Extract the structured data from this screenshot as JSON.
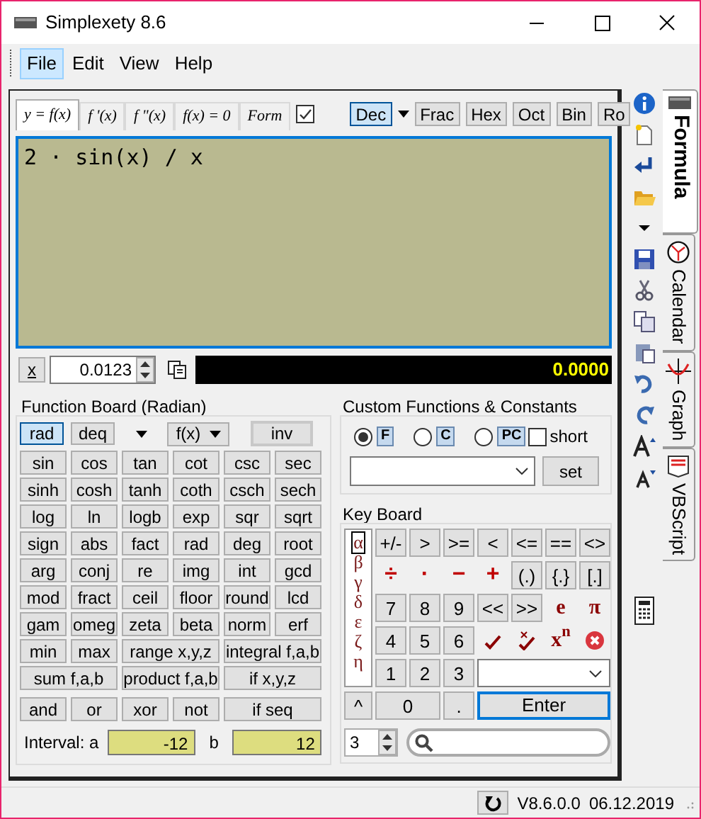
{
  "window": {
    "title": "Simplexety 8.6"
  },
  "menu": [
    {
      "label": "File",
      "highlighted": true
    },
    {
      "label": "Edit",
      "highlighted": false
    },
    {
      "label": "View",
      "highlighted": false
    },
    {
      "label": "Help",
      "highlighted": false
    }
  ],
  "formula_tabs": [
    {
      "label": "y = f(x)",
      "selected": true
    },
    {
      "label": "f '(x)",
      "selected": false
    },
    {
      "label": "f \"(x)",
      "selected": false
    },
    {
      "label": "f(x) = 0",
      "selected": false
    },
    {
      "label": "Form",
      "selected": false
    }
  ],
  "formula_checkbox": {
    "checked": true
  },
  "number_formats": [
    {
      "label": "Dec",
      "selected": true
    },
    {
      "label": "Frac",
      "selected": false
    },
    {
      "label": "Hex",
      "selected": false
    },
    {
      "label": "Oct",
      "selected": false
    },
    {
      "label": "Bin",
      "selected": false
    },
    {
      "label": "Ro",
      "selected": false
    }
  ],
  "expression": "2 · sin(x) / x",
  "x_button": "x",
  "x_value": "0.0123",
  "result": "0.0000",
  "function_board": {
    "title": "Function Board (Radian)",
    "modes": [
      {
        "label": "rad",
        "selected": true
      },
      {
        "label": "deq",
        "selected": false
      }
    ],
    "fx_dropdown": "f(x)",
    "inv_button": "inv",
    "buttons": [
      {
        "label": "sin",
        "kind": "single"
      },
      {
        "label": "cos",
        "kind": "single"
      },
      {
        "label": "tan",
        "kind": "single"
      },
      {
        "label": "cot",
        "kind": "single"
      },
      {
        "label": "csc",
        "kind": "single"
      },
      {
        "label": "sec",
        "kind": "single"
      },
      {
        "label": "sinh",
        "kind": "single"
      },
      {
        "label": "cosh",
        "kind": "single"
      },
      {
        "label": "tanh",
        "kind": "single"
      },
      {
        "label": "coth",
        "kind": "single"
      },
      {
        "label": "csch",
        "kind": "single"
      },
      {
        "label": "sech",
        "kind": "single"
      },
      {
        "label": "log",
        "kind": "single"
      },
      {
        "label": "ln",
        "kind": "single"
      },
      {
        "label": "logb",
        "kind": "single"
      },
      {
        "label": "exp",
        "kind": "single"
      },
      {
        "label": "sqr",
        "kind": "single"
      },
      {
        "label": "sqrt",
        "kind": "single"
      },
      {
        "label": "sign",
        "kind": "single"
      },
      {
        "label": "abs",
        "kind": "single"
      },
      {
        "label": "fact",
        "kind": "single"
      },
      {
        "label": "rad",
        "kind": "single"
      },
      {
        "label": "deg",
        "kind": "single"
      },
      {
        "label": "root",
        "kind": "single"
      },
      {
        "label": "arg",
        "kind": "single"
      },
      {
        "label": "conj",
        "kind": "single"
      },
      {
        "label": "re",
        "kind": "single"
      },
      {
        "label": "img",
        "kind": "single"
      },
      {
        "label": "int",
        "kind": "single"
      },
      {
        "label": "gcd",
        "kind": "single"
      },
      {
        "label": "mod",
        "kind": "single"
      },
      {
        "label": "fract",
        "kind": "single"
      },
      {
        "label": "ceil",
        "kind": "single"
      },
      {
        "label": "floor",
        "kind": "single"
      },
      {
        "label": "round",
        "kind": "single"
      },
      {
        "label": "lcd",
        "kind": "single"
      },
      {
        "label": "gam",
        "kind": "single"
      },
      {
        "label": "omeg",
        "kind": "single"
      },
      {
        "label": "zeta",
        "kind": "single"
      },
      {
        "label": "beta",
        "kind": "single"
      },
      {
        "label": "norm",
        "kind": "single"
      },
      {
        "label": "erf",
        "kind": "single"
      },
      {
        "label": "min",
        "kind": "single"
      },
      {
        "label": "max",
        "kind": "single"
      },
      {
        "label": "range x,y,z",
        "kind": "wide"
      },
      {
        "label": "integral f,a,b",
        "kind": "wide"
      },
      {
        "label": "sum f,a,b",
        "kind": "wide"
      },
      {
        "label": "product f,a,b",
        "kind": "wide"
      },
      {
        "label": "if x,y,z",
        "kind": "wide"
      }
    ],
    "logic_buttons": [
      {
        "label": "and",
        "kind": "single"
      },
      {
        "label": "or",
        "kind": "single"
      },
      {
        "label": "xor",
        "kind": "single"
      },
      {
        "label": "not",
        "kind": "single"
      },
      {
        "label": "if seq",
        "kind": "wide"
      }
    ],
    "interval": {
      "label_a": "Interval: a",
      "a": "-12",
      "label_b": "b",
      "b": "12"
    }
  },
  "custom": {
    "title": "Custom Functions & Constants",
    "options": [
      {
        "label": "F",
        "selected": true
      },
      {
        "label": "C",
        "selected": false
      },
      {
        "label": "PC",
        "selected": false
      }
    ],
    "short": {
      "label": "short",
      "checked": false
    },
    "set_button": "set"
  },
  "keyboard": {
    "title": "Key Board",
    "greek": [
      {
        "label": "α",
        "selected": true
      },
      {
        "label": "β",
        "selected": false
      },
      {
        "label": "γ",
        "selected": false
      },
      {
        "label": "δ",
        "selected": false
      },
      {
        "label": "ε",
        "selected": false
      },
      {
        "label": "ζ",
        "selected": false
      },
      {
        "label": "η",
        "selected": false
      }
    ],
    "keys": [
      {
        "label": "+/-",
        "kind": "key"
      },
      {
        "label": ">",
        "kind": "key"
      },
      {
        "label": ">=",
        "kind": "key"
      },
      {
        "label": "<",
        "kind": "key"
      },
      {
        "label": "<=",
        "kind": "key"
      },
      {
        "label": "==",
        "kind": "key"
      },
      {
        "label": "<>",
        "kind": "key"
      },
      {
        "label": "÷",
        "kind": "sign"
      },
      {
        "label": "·",
        "kind": "sign"
      },
      {
        "label": "−",
        "kind": "sign"
      },
      {
        "label": "+",
        "kind": "sign"
      },
      {
        "label": "(.)",
        "kind": "key"
      },
      {
        "label": "{.}",
        "kind": "key"
      },
      {
        "label": "[.]",
        "kind": "key"
      },
      {
        "label": "7",
        "kind": "key"
      },
      {
        "label": "8",
        "kind": "key"
      },
      {
        "label": "9",
        "kind": "key"
      },
      {
        "label": "<<",
        "kind": "key"
      },
      {
        "label": ">>",
        "kind": "key"
      },
      {
        "label": "e",
        "kind": "letter"
      },
      {
        "label": "π",
        "kind": "letter"
      },
      {
        "label": "4",
        "kind": "key"
      },
      {
        "label": "5",
        "kind": "key"
      },
      {
        "label": "6",
        "kind": "key"
      },
      {
        "kind": "check"
      },
      {
        "kind": "checkx"
      },
      {
        "label": "x$^{n}$",
        "kind": "letter"
      },
      {
        "kind": "clear"
      },
      {
        "label": "1",
        "kind": "key"
      },
      {
        "label": "2",
        "kind": "key"
      },
      {
        "label": "3",
        "kind": "key"
      },
      {
        "kind": "dropdown"
      },
      {
        "label": "^",
        "kind": "key"
      },
      {
        "label": "0",
        "kind": "wide"
      },
      {
        "label": ".",
        "kind": "key"
      },
      {
        "label": "Enter",
        "kind": "enter"
      }
    ],
    "spin_value": "3"
  },
  "side_tabs": [
    {
      "label": "Formula",
      "selected": true
    },
    {
      "label": "Calendar",
      "selected": false
    },
    {
      "label": "Graph",
      "selected": false
    },
    {
      "label": "VBScript",
      "selected": false
    }
  ],
  "status_bar": {
    "version": "V8.6.0.0",
    "date": "06.12.2019"
  }
}
